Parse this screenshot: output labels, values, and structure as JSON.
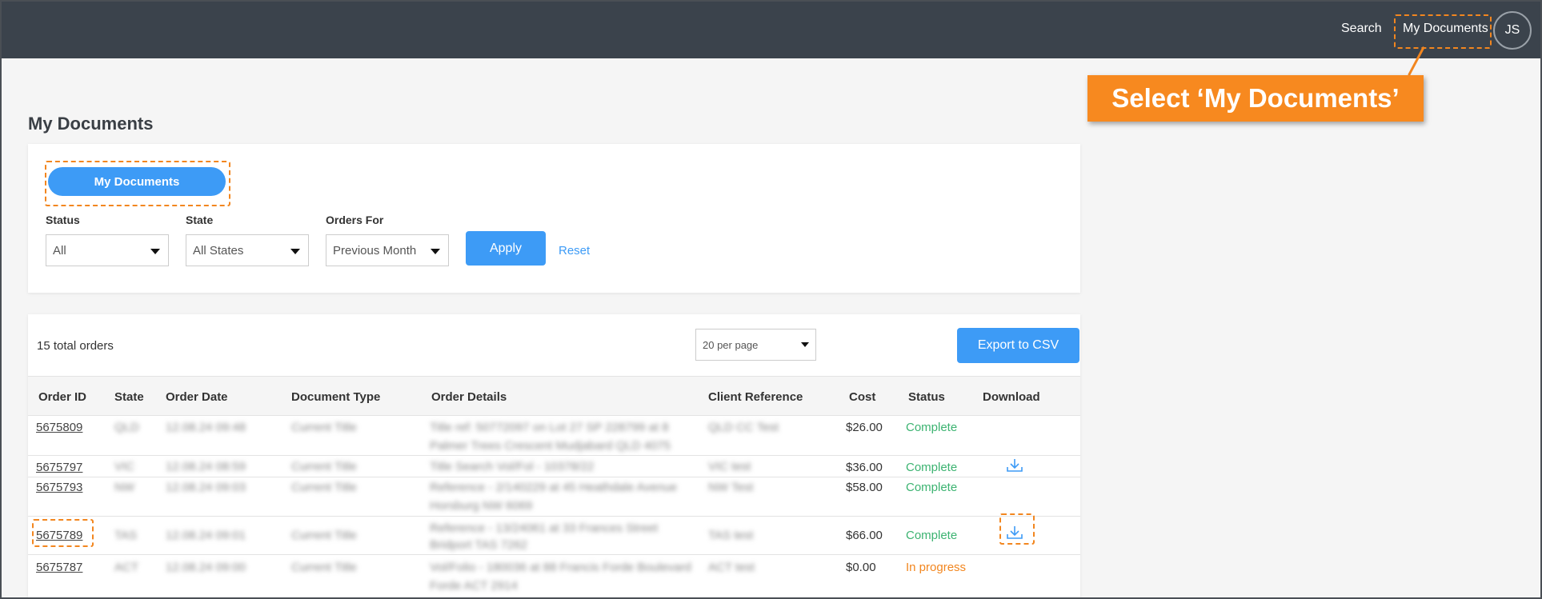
{
  "nav": {
    "search": "Search",
    "my_documents": "My Documents",
    "avatar_initials": "JS"
  },
  "callout": {
    "text": "Select ‘My Documents’",
    "color": "#f7891f"
  },
  "page": {
    "title": "My Documents"
  },
  "filters": {
    "my_documents_button": "My Documents",
    "status": {
      "label": "Status",
      "value": "All"
    },
    "state": {
      "label": "State",
      "value": "All States"
    },
    "orders_for": {
      "label": "Orders For",
      "value": "Previous Month"
    },
    "apply": "Apply",
    "reset": "Reset"
  },
  "orders": {
    "total_text": "15 total orders",
    "per_page": "20 per page",
    "export": "Export to CSV",
    "columns": [
      "Order ID",
      "State",
      "Order Date",
      "Document Type",
      "Order Details",
      "Client Reference",
      "Cost",
      "Status",
      "Download"
    ],
    "rows": [
      {
        "order_id": "5675809",
        "state": "QLD",
        "date": "12.08.24 09:48",
        "doc_type": "Current Title",
        "details": [
          "Title ref: 50772097 on Lot 27 SP 228799 at 8",
          "Palmer Trees Crescent Mudjabard QLD 4075"
        ],
        "client_ref": "QLD CC Test",
        "cost": "$26.00",
        "status": "Complete",
        "download": false
      },
      {
        "order_id": "5675797",
        "state": "VIC",
        "date": "12.08.24 08:59",
        "doc_type": "Current Title",
        "details": [
          "Title Search Vol/Fol - 10378/22"
        ],
        "client_ref": "VIC test",
        "cost": "$36.00",
        "status": "Complete",
        "download": true
      },
      {
        "order_id": "5675793",
        "state": "NW",
        "date": "12.08.24 09:03",
        "doc_type": "Current Title",
        "details": [
          "Reference - 2/140229 at 45 Heathdale Avenue",
          "Horsburg NW 6069"
        ],
        "client_ref": "NW Test",
        "cost": "$58.00",
        "status": "Complete",
        "download": false
      },
      {
        "order_id": "5675789",
        "state": "TAS",
        "date": "12.08.24 09:01",
        "doc_type": "Current Title",
        "details": [
          "Reference - 13/24061 at 33 Frances Street",
          "Bridport TAS 7262"
        ],
        "client_ref": "TAS test",
        "cost": "$66.00",
        "status": "Complete",
        "download": true
      },
      {
        "order_id": "5675787",
        "state": "ACT",
        "date": "12.08.24 09:00",
        "doc_type": "Current Title",
        "details": [
          "Vol/Folio - 180036 at 88 Francis Forde Boulevard",
          "Forde ACT 2914"
        ],
        "client_ref": "ACT test",
        "cost": "$0.00",
        "status": "In progress",
        "download": false
      }
    ]
  },
  "colors": {
    "topbar": "#3b434c",
    "primary_button": "#3d9bf6",
    "highlight": "#f2861f",
    "status_complete": "#3cb371",
    "status_in_progress": "#f2861f"
  }
}
